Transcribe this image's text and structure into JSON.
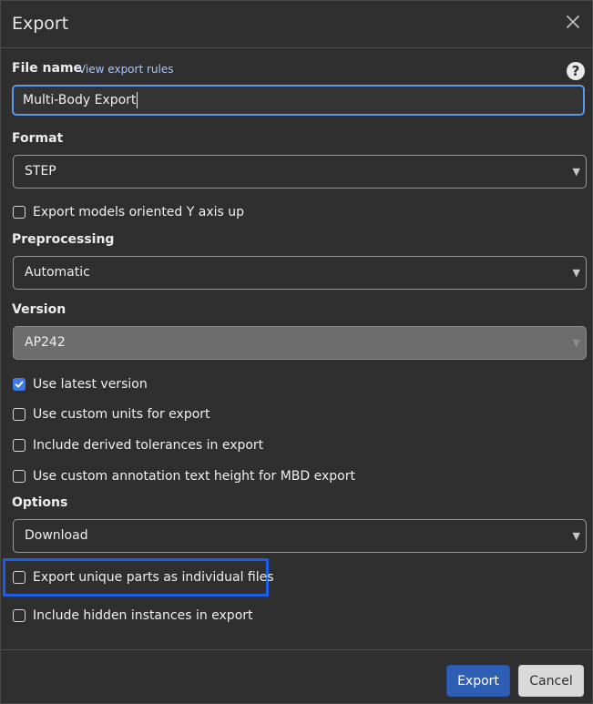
{
  "dialog": {
    "title": "Export",
    "close_icon": "close-icon",
    "help_icon": "help-icon"
  },
  "file_name": {
    "label": "File name",
    "link": "View export rules",
    "value": "Multi-Body Export"
  },
  "format": {
    "label": "Format",
    "selected": "STEP"
  },
  "checkboxes": {
    "y_axis_up": {
      "label": "Export models oriented Y axis up",
      "checked": false
    },
    "latest_version": {
      "label": "Use latest version",
      "checked": true
    },
    "custom_units": {
      "label": "Use custom units for export",
      "checked": false
    },
    "derived_tolerances": {
      "label": "Include derived tolerances in export",
      "checked": false
    },
    "annotation_height": {
      "label": "Use custom annotation text height for MBD export",
      "checked": false
    },
    "unique_parts": {
      "label": "Export unique parts as individual files",
      "checked": false
    },
    "hidden_instances": {
      "label": "Include hidden instances in export",
      "checked": false
    }
  },
  "preprocessing": {
    "label": "Preprocessing",
    "selected": "Automatic"
  },
  "version": {
    "label": "Version",
    "selected": "AP242"
  },
  "options": {
    "label": "Options",
    "selected": "Download"
  },
  "footer": {
    "export_label": "Export",
    "cancel_label": "Cancel"
  },
  "colors": {
    "background": "#2f2f2f",
    "accent": "#3f7be6",
    "highlight": "#1c5eea"
  }
}
